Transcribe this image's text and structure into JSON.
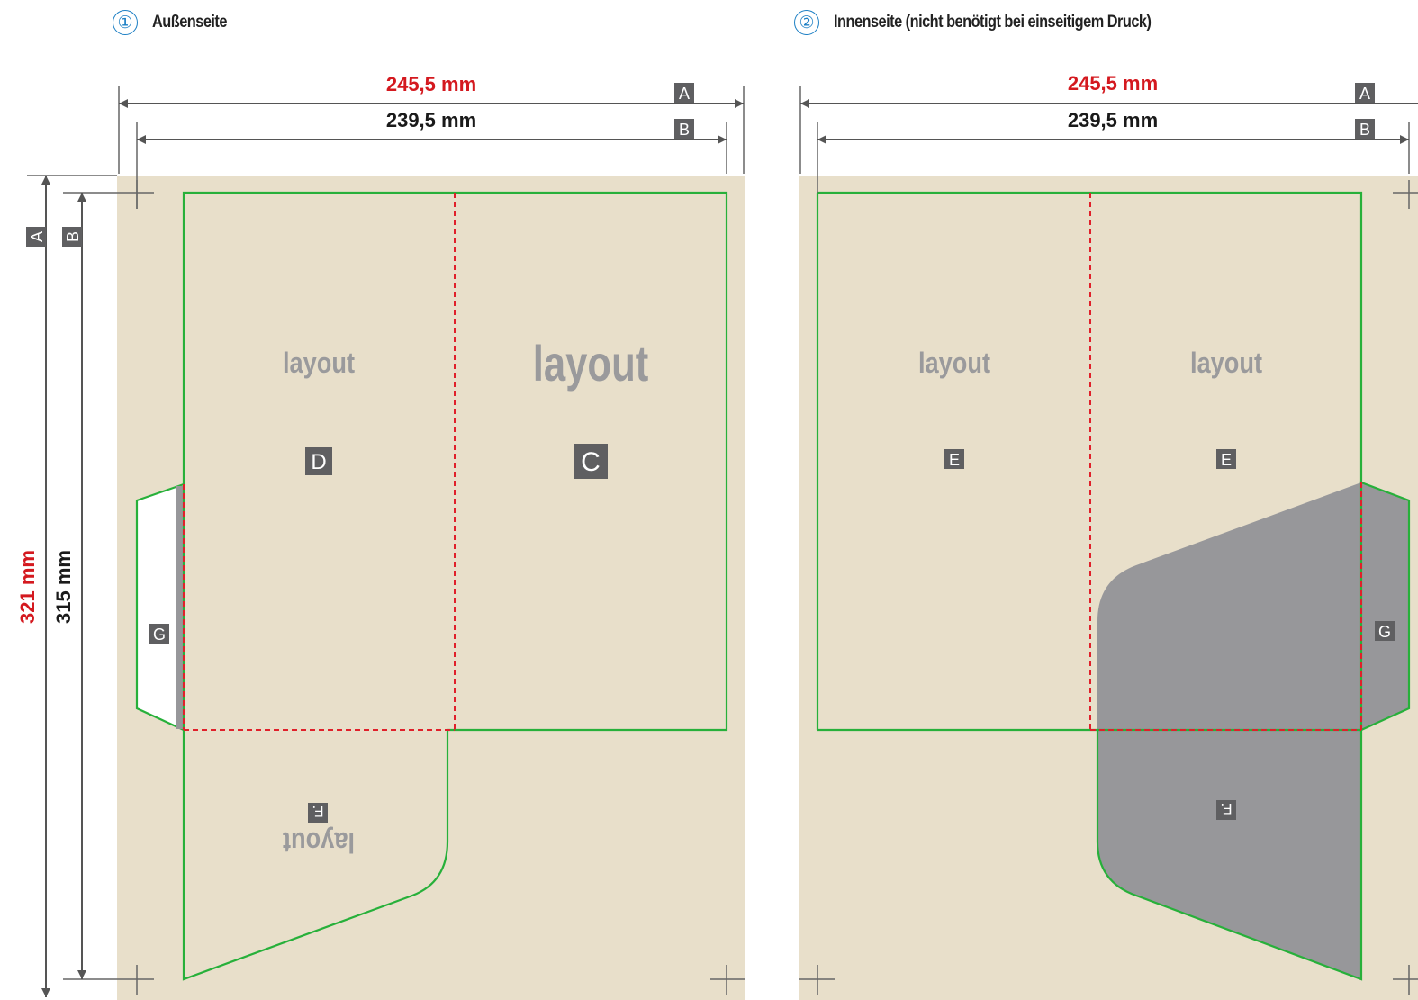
{
  "panels": {
    "outer": {
      "number": "①",
      "title": "Außenseite"
    },
    "inner": {
      "number": "②",
      "title": "Innenseite (nicht benötigt bei einseitigem Druck)"
    }
  },
  "dimensions": {
    "width_total": "245,5 mm",
    "width_trim": "239,5 mm",
    "height_total": "321 mm",
    "height_trim": "315 mm"
  },
  "markers": {
    "a": "A",
    "b": "B",
    "c": "C",
    "d": "D",
    "e": "E",
    "f": "F.",
    "g": "G"
  },
  "placeholder": "layout",
  "colors": {
    "paper": "#e8dfca",
    "cut_line": "#27b03a",
    "fold_line": "#e0202a",
    "dimension_red": "#d4191f",
    "pocket_gray": "#97979a",
    "badge_gray": "#5f5f61"
  }
}
